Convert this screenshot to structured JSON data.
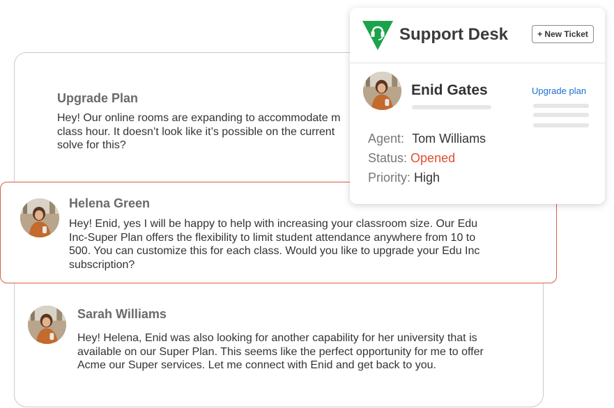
{
  "thread": {
    "upgrade": {
      "title": "Upgrade Plan",
      "lines": [
        "Hey! Our online rooms are expanding to accommodate m",
        "class hour. It doesn’t look like it’s possible on the current",
        "solve for this?"
      ]
    },
    "messages": [
      {
        "author": "Helena Green",
        "lines": [
          "Hey! Enid, yes I will be happy to help with increasing your classroom size. Our Edu",
          "Inc-Super Plan offers the flexibility to limit student attendance anywhere from 10 to",
          "500. You can customize this for each class. Would you like to upgrade your Edu Inc",
          "subscription?"
        ]
      },
      {
        "author": "Sarah Williams",
        "lines": [
          "Hey! Helena, Enid was also looking for another capability for her university that is",
          "available on our Super Plan. This seems like the perfect opportunity for me to offer",
          "Acme our Super services. Let me connect with Enid and get back to you."
        ]
      }
    ]
  },
  "support_panel": {
    "title": "Support Desk",
    "new_ticket_label": "+ New Ticket",
    "customer_name": "Enid Gates",
    "upgrade_link": "Upgrade plan",
    "agent_label": "Agent:",
    "agent_value": "Tom Williams",
    "status_label": "Status:",
    "status_value": "Opened",
    "priority_label": "Priority:",
    "priority_value": "High"
  },
  "colors": {
    "brand_green": "#1aa34a",
    "status_red": "#e04e2d",
    "link_blue": "#1a6fd1",
    "highlight_border": "#d85c45"
  },
  "icons": {
    "logo": "headset-triangle-logo",
    "avatar": "user-photo-avatar"
  }
}
